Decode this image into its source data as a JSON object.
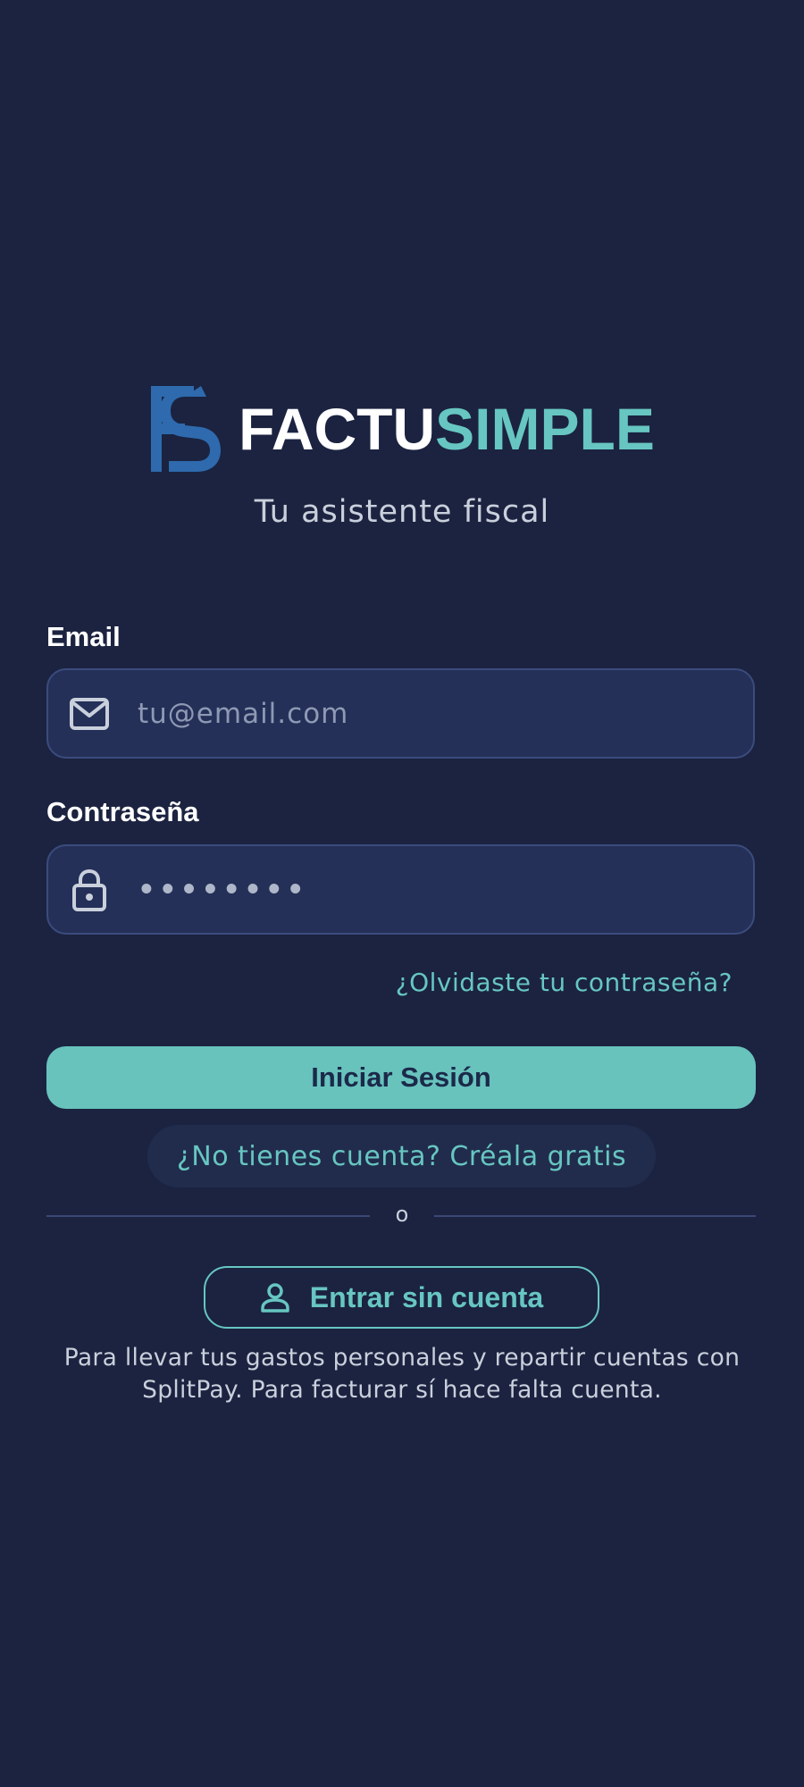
{
  "brand": {
    "name_part1": "FACTU",
    "name_part2": "SIMPLE",
    "tagline": "Tu asistente fiscal",
    "colors": {
      "primary_dark_blue": "#2e6aad",
      "accent_teal": "#67c6c1",
      "background": "#1b2340"
    }
  },
  "form": {
    "email": {
      "label": "Email",
      "placeholder": "tu@email.com",
      "value": "",
      "icon": "mail-icon"
    },
    "password": {
      "label": "Contraseña",
      "placeholder": "••••••••",
      "value": "",
      "icon": "lock-icon"
    },
    "forgot_link": "¿Olvidaste tu contraseña?",
    "login_button": "Iniciar Sesión",
    "signup_link": "¿No tienes cuenta? Créala gratis"
  },
  "divider_text": "o",
  "guest": {
    "button_label": "Entrar sin cuenta",
    "icon": "user-icon",
    "note": "Para llevar tus gastos personales y repartir cuentas con SplitPay. Para facturar sí hace falta cuenta."
  }
}
